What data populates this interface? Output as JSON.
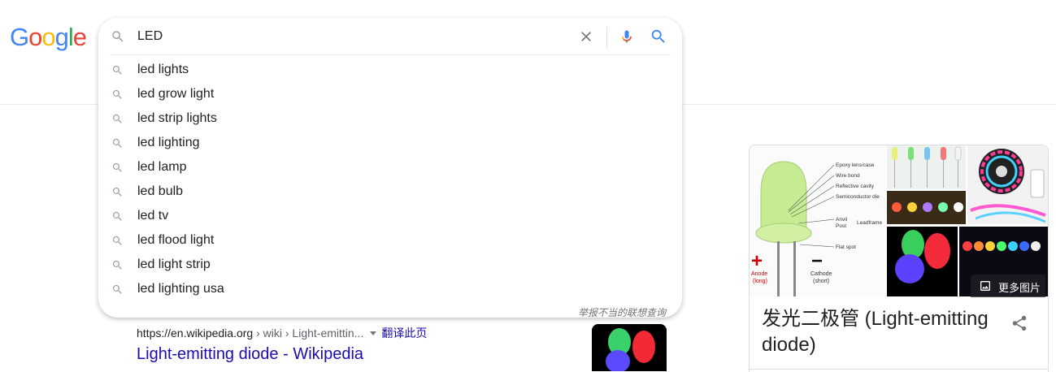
{
  "logo": {
    "text": "Google"
  },
  "search": {
    "value": "LED",
    "placeholder": "",
    "suggestions": [
      "led lights",
      "led grow light",
      "led strip lights",
      "led lighting",
      "led lamp",
      "led bulb",
      "led tv",
      "led flood light",
      "led light strip",
      "led lighting usa"
    ],
    "report_text": "举报不当的联想查询"
  },
  "result": {
    "url_host": "https://en.wikipedia.org",
    "url_path": " › wiki › Light-emittin...",
    "translate_label": "翻译此页",
    "title": "Light-emitting diode - Wikipedia"
  },
  "knowledge_panel": {
    "title": "发光二极管 (Light-emitting diode)",
    "more_images_label": "更多图片",
    "diagram_labels": {
      "epoxy": "Epoxy lens/case",
      "wire_bond": "Wire bond",
      "reflective": "Reflective cavity",
      "semiconductor": "Semiconductor die",
      "anvil": "Anvil",
      "post": "Post",
      "leadframe": "Leadframe",
      "flat_spot": "Flat spot",
      "anode": "Anode",
      "anode_sub": "(long)",
      "cathode": "Cathode",
      "cathode_sub": "(short)"
    }
  },
  "colors": {
    "link": "#1a0dab",
    "google_blue": "#4285f4",
    "google_red": "#ea4335",
    "google_yellow": "#fbbc05",
    "google_green": "#34a853"
  }
}
